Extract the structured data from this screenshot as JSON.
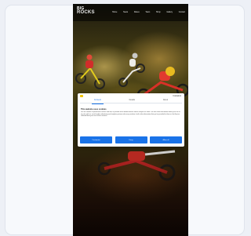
{
  "site": {
    "logo_line1": "BIG",
    "logo_line2": "ROCKS",
    "nav": [
      "Home",
      "News",
      "Races",
      "Team",
      "Shop",
      "Gallery",
      "Contact"
    ]
  },
  "cookie_dialog": {
    "tabs": [
      "Consent",
      "Details",
      "About"
    ],
    "active_tab": 0,
    "brand": "Cookiebot",
    "heading": "This website uses cookies",
    "body": "We use cookies to personalise content and ads, to provide social media features and to analyse our traffic. We also share information about your use of our site with our social media, advertising and analytics partners who may combine it with other information that you've provided to them or that they've collected from your use of their services.",
    "buttons": {
      "customize": "Customize",
      "deny": "Deny",
      "allow_all": "Allow all"
    }
  },
  "colors": {
    "accent": "#1a73e8",
    "page_bg": "#edf0f6",
    "card_bg": "#f7f9fc"
  }
}
